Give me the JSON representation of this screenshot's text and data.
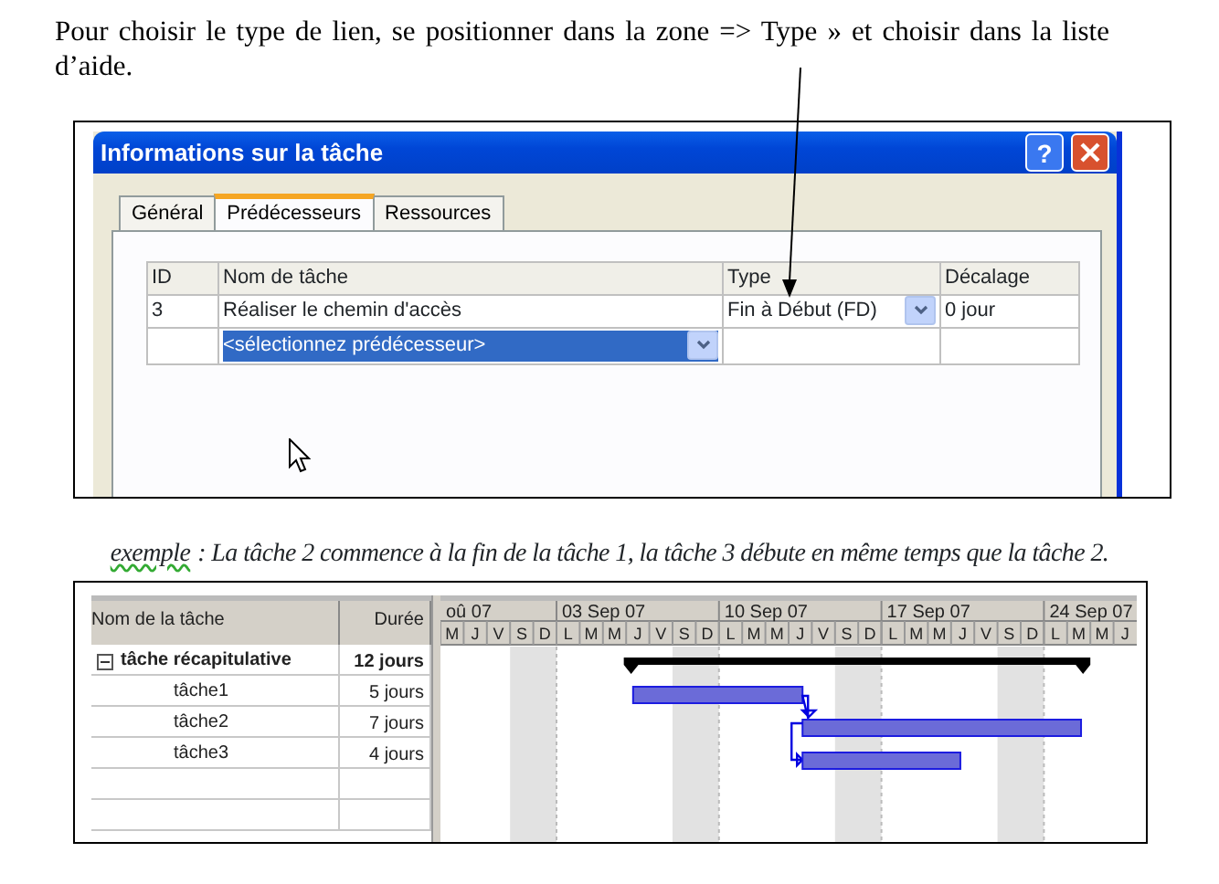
{
  "instruction": "Pour choisir le type de lien, se positionner dans la zone => Type » et choisir dans la liste d’aide.",
  "dialog": {
    "title": "Informations sur la tâche",
    "help_button": "?",
    "tabs": [
      {
        "label": "Général",
        "selected": false
      },
      {
        "label": "Prédécesseurs",
        "selected": true
      },
      {
        "label": "Ressources",
        "selected": false
      }
    ],
    "grid": {
      "columns": [
        "ID",
        "Nom de tâche",
        "Type",
        "Décalage"
      ],
      "rows": [
        {
          "id": "3",
          "name": "Réaliser le chemin d'accès",
          "type": "Fin à Début (FD)",
          "lag": "0 jour",
          "selected": false
        },
        {
          "name": "<sélectionnez prédécesseur>",
          "selected": true
        }
      ]
    }
  },
  "caption": {
    "label": "exemple",
    "text": ": La tâche 2 commence à la fin de la tâche 1, la tâche 3 débute en même temps que la tâche 2."
  },
  "gantt": {
    "columns": [
      "Nom de la tâche",
      "Durée"
    ],
    "tasks": [
      {
        "name": "tâche récapitulative",
        "duration": "12 jours",
        "kind": "summary",
        "expanded": true,
        "children": [
          {
            "name": "tâche1",
            "duration": "5 jours"
          },
          {
            "name": "tâche2",
            "duration": "7 jours"
          },
          {
            "name": "tâche3",
            "duration": "4 jours"
          }
        ]
      }
    ],
    "weeks": [
      "oû 07",
      "03 Sep 07",
      "10 Sep 07",
      "17 Sep 07",
      "24 Sep 07"
    ],
    "days": [
      "M",
      "J",
      "V",
      "S",
      "D",
      "L",
      "M",
      "M",
      "J",
      "V",
      "S",
      "D",
      "L",
      "M",
      "M",
      "J",
      "V",
      "S",
      "D",
      "L",
      "M",
      "M",
      "J",
      "V",
      "S",
      "D",
      "L",
      "M",
      "M",
      "J"
    ]
  }
}
